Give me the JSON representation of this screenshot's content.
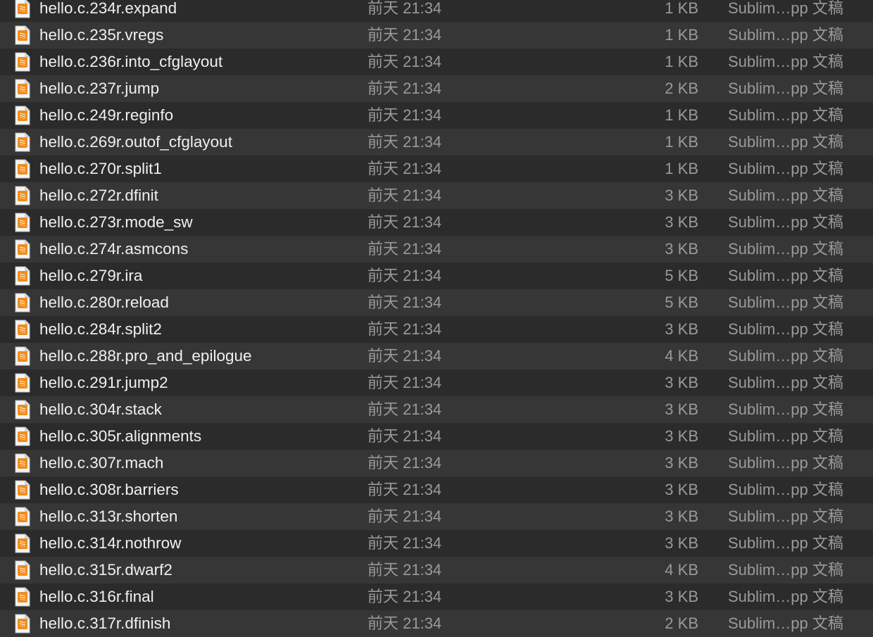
{
  "files": [
    {
      "name": "hello.c.234r.expand",
      "date": "前天 21:34",
      "size": "1 KB",
      "kind": "Sublim…pp 文稿"
    },
    {
      "name": "hello.c.235r.vregs",
      "date": "前天 21:34",
      "size": "1 KB",
      "kind": "Sublim…pp 文稿"
    },
    {
      "name": "hello.c.236r.into_cfglayout",
      "date": "前天 21:34",
      "size": "1 KB",
      "kind": "Sublim…pp 文稿"
    },
    {
      "name": "hello.c.237r.jump",
      "date": "前天 21:34",
      "size": "2 KB",
      "kind": "Sublim…pp 文稿"
    },
    {
      "name": "hello.c.249r.reginfo",
      "date": "前天 21:34",
      "size": "1 KB",
      "kind": "Sublim…pp 文稿"
    },
    {
      "name": "hello.c.269r.outof_cfglayout",
      "date": "前天 21:34",
      "size": "1 KB",
      "kind": "Sublim…pp 文稿"
    },
    {
      "name": "hello.c.270r.split1",
      "date": "前天 21:34",
      "size": "1 KB",
      "kind": "Sublim…pp 文稿"
    },
    {
      "name": "hello.c.272r.dfinit",
      "date": "前天 21:34",
      "size": "3 KB",
      "kind": "Sublim…pp 文稿"
    },
    {
      "name": "hello.c.273r.mode_sw",
      "date": "前天 21:34",
      "size": "3 KB",
      "kind": "Sublim…pp 文稿"
    },
    {
      "name": "hello.c.274r.asmcons",
      "date": "前天 21:34",
      "size": "3 KB",
      "kind": "Sublim…pp 文稿"
    },
    {
      "name": "hello.c.279r.ira",
      "date": "前天 21:34",
      "size": "5 KB",
      "kind": "Sublim…pp 文稿"
    },
    {
      "name": "hello.c.280r.reload",
      "date": "前天 21:34",
      "size": "5 KB",
      "kind": "Sublim…pp 文稿"
    },
    {
      "name": "hello.c.284r.split2",
      "date": "前天 21:34",
      "size": "3 KB",
      "kind": "Sublim…pp 文稿"
    },
    {
      "name": "hello.c.288r.pro_and_epilogue",
      "date": "前天 21:34",
      "size": "4 KB",
      "kind": "Sublim…pp 文稿"
    },
    {
      "name": "hello.c.291r.jump2",
      "date": "前天 21:34",
      "size": "3 KB",
      "kind": "Sublim…pp 文稿"
    },
    {
      "name": "hello.c.304r.stack",
      "date": "前天 21:34",
      "size": "3 KB",
      "kind": "Sublim…pp 文稿"
    },
    {
      "name": "hello.c.305r.alignments",
      "date": "前天 21:34",
      "size": "3 KB",
      "kind": "Sublim…pp 文稿"
    },
    {
      "name": "hello.c.307r.mach",
      "date": "前天 21:34",
      "size": "3 KB",
      "kind": "Sublim…pp 文稿"
    },
    {
      "name": "hello.c.308r.barriers",
      "date": "前天 21:34",
      "size": "3 KB",
      "kind": "Sublim…pp 文稿"
    },
    {
      "name": "hello.c.313r.shorten",
      "date": "前天 21:34",
      "size": "3 KB",
      "kind": "Sublim…pp 文稿"
    },
    {
      "name": "hello.c.314r.nothrow",
      "date": "前天 21:34",
      "size": "3 KB",
      "kind": "Sublim…pp 文稿"
    },
    {
      "name": "hello.c.315r.dwarf2",
      "date": "前天 21:34",
      "size": "4 KB",
      "kind": "Sublim…pp 文稿"
    },
    {
      "name": "hello.c.316r.final",
      "date": "前天 21:34",
      "size": "3 KB",
      "kind": "Sublim…pp 文稿"
    },
    {
      "name": "hello.c.317r.dfinish",
      "date": "前天 21:34",
      "size": "2 KB",
      "kind": "Sublim…pp 文稿"
    }
  ],
  "icon": "sublime-text-document-icon",
  "colors": {
    "row_even": "#2b2b2b",
    "row_odd": "#363636",
    "icon_accent": "#f08c1c",
    "name_text": "#f0f0f0",
    "meta_text": "#9a9a9a"
  }
}
